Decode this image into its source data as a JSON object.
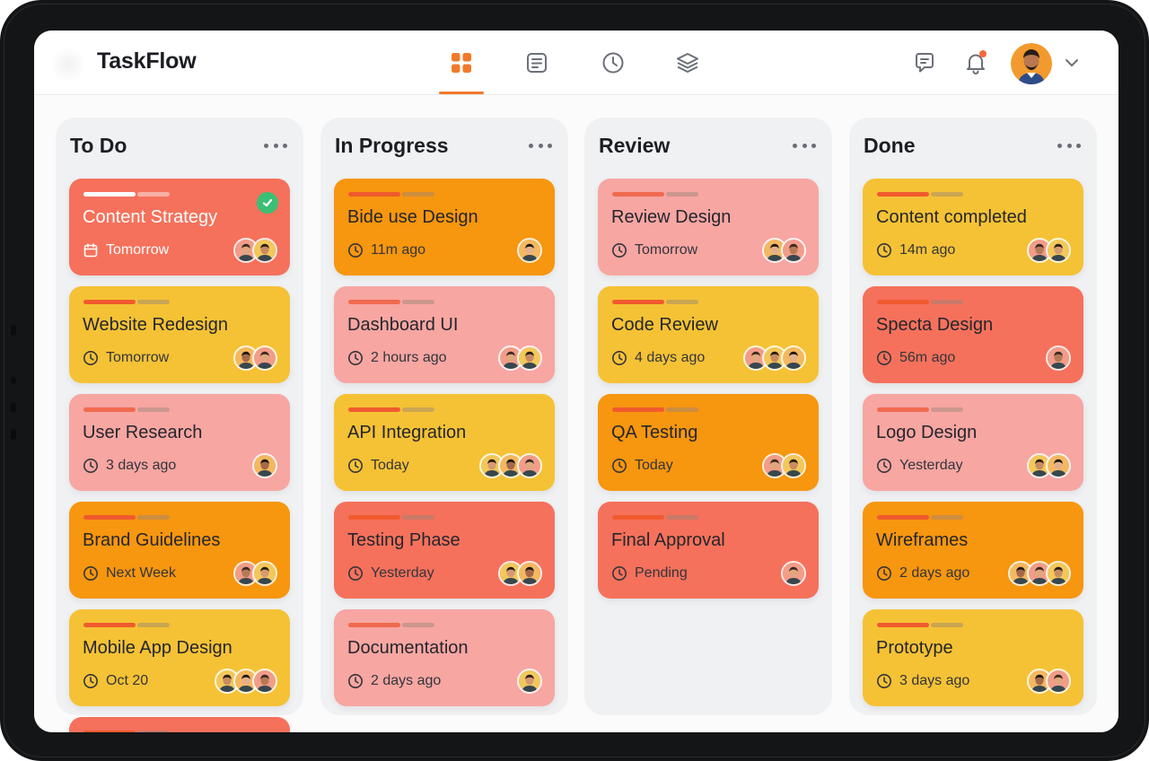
{
  "app": {
    "title": "TaskFlow"
  },
  "nav": [
    {
      "name": "board",
      "icon": "grid-icon",
      "active": true
    },
    {
      "name": "list",
      "icon": "document-icon",
      "active": false
    },
    {
      "name": "history",
      "icon": "clock-icon",
      "active": false
    },
    {
      "name": "layers",
      "icon": "layers-icon",
      "active": false
    }
  ],
  "header_icons": [
    "chat-icon",
    "bell-icon"
  ],
  "colors": {
    "accent": "#f07a2c",
    "coral": "#f5715c",
    "yellow": "#f5c235",
    "pink": "#f7a6a2",
    "orange": "#f7960f"
  },
  "columns": [
    {
      "title": "To Do",
      "cards": [
        {
          "title": "Content Strategy",
          "meta": "Tomorrow",
          "color": "coral",
          "meta_icon": "calendar-icon",
          "avatars": 2,
          "checked": true
        },
        {
          "title": "Website Redesign",
          "meta": "Tomorrow",
          "color": "yellow",
          "meta_icon": "clock-icon",
          "avatars": 2
        },
        {
          "title": "User Research",
          "meta": "3 days ago",
          "color": "pink",
          "meta_icon": "clock-icon",
          "avatars": 1
        },
        {
          "title": "Brand Guidelines",
          "meta": "Next Week",
          "color": "orange",
          "meta_icon": "clock-icon",
          "avatars": 2
        },
        {
          "title": "Mobile App Design",
          "meta": "Oct 20",
          "color": "yellow",
          "meta_icon": "clock-icon",
          "avatars": 3
        },
        {
          "title": "",
          "meta": "",
          "color": "coral",
          "meta_icon": "",
          "avatars": 0
        }
      ]
    },
    {
      "title": "In Progress",
      "cards": [
        {
          "title": "Bide use Design",
          "meta": "11m ago",
          "color": "orange",
          "meta_icon": "clock-icon",
          "avatars": 1
        },
        {
          "title": "Dashboard UI",
          "meta": "2 hours ago",
          "color": "pink",
          "meta_icon": "clock-icon",
          "avatars": 2
        },
        {
          "title": "API Integration",
          "meta": "Today",
          "color": "yellow",
          "meta_icon": "clock-icon",
          "avatars": 3
        },
        {
          "title": "Testing Phase",
          "meta": "Yesterday",
          "color": "coral",
          "meta_icon": "clock-icon",
          "avatars": 2
        },
        {
          "title": "Documentation",
          "meta": "2 days ago",
          "color": "pink",
          "meta_icon": "clock-icon",
          "avatars": 1
        }
      ]
    },
    {
      "title": "Review",
      "cards": [
        {
          "title": "Review Design",
          "meta": "Tomorrow",
          "color": "pink",
          "meta_icon": "clock-icon",
          "avatars": 2
        },
        {
          "title": "Code Review",
          "meta": "4 days ago",
          "color": "yellow",
          "meta_icon": "clock-icon",
          "avatars": 3
        },
        {
          "title": "QA Testing",
          "meta": "Today",
          "color": "orange",
          "meta_icon": "clock-icon",
          "avatars": 2
        },
        {
          "title": "Final Approval",
          "meta": "Pending",
          "color": "coral",
          "meta_icon": "clock-icon",
          "avatars": 1
        }
      ]
    },
    {
      "title": "Done",
      "cards": [
        {
          "title": "Content completed",
          "meta": "14m ago",
          "color": "yellow",
          "meta_icon": "clock-icon",
          "avatars": 2
        },
        {
          "title": "Specta Design",
          "meta": "56m ago",
          "color": "coral",
          "meta_icon": "clock-icon",
          "avatars": 1
        },
        {
          "title": "Logo Design",
          "meta": "Yesterday",
          "color": "pink",
          "meta_icon": "clock-icon",
          "avatars": 2
        },
        {
          "title": "Wireframes",
          "meta": "2 days ago",
          "color": "orange",
          "meta_icon": "clock-icon",
          "avatars": 3
        },
        {
          "title": "Prototype",
          "meta": "3 days ago",
          "color": "yellow",
          "meta_icon": "clock-icon",
          "avatars": 2
        }
      ]
    }
  ]
}
